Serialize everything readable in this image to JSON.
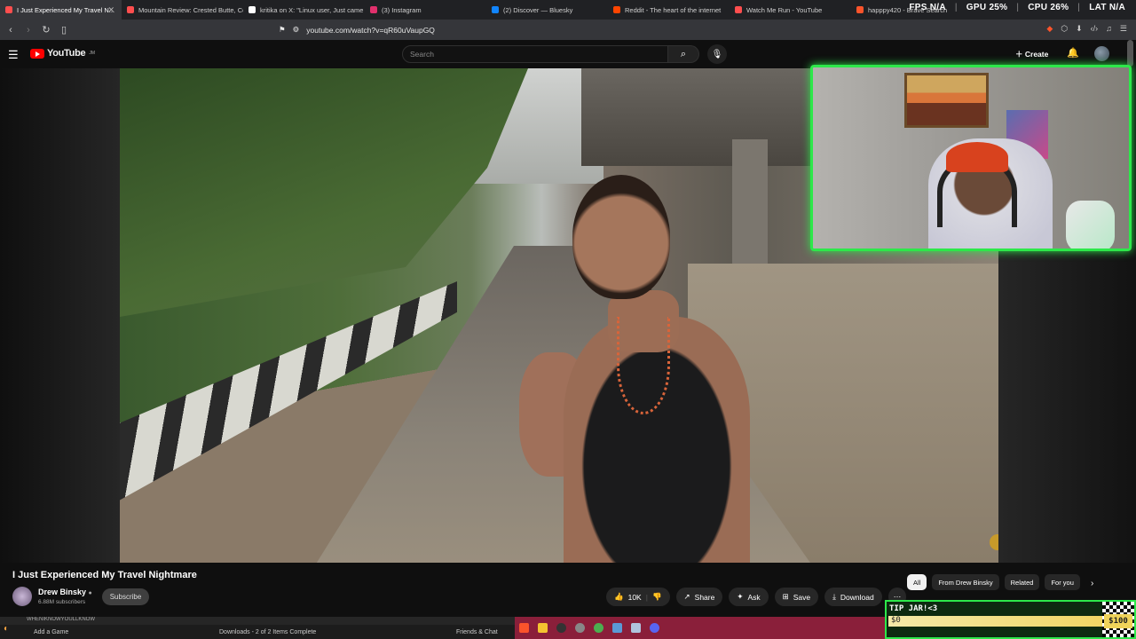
{
  "tabs": [
    {
      "label": "I Just Experienced My Travel N...",
      "color": "#ff4e4e",
      "active": true
    },
    {
      "label": "Mountain Review: Crested Butte, Colo...",
      "color": "#ff4e4e"
    },
    {
      "label": "kritika on X: \"Linux user, Just came a...",
      "color": "#ffffff"
    },
    {
      "label": "(3) Instagram",
      "color": "#e1306c"
    },
    {
      "label": "(2) Discover — Bluesky",
      "color": "#1185fe"
    },
    {
      "label": "Reddit - The heart of the internet",
      "color": "#ff4500"
    },
    {
      "label": "Watch Me Run - YouTube",
      "color": "#ff4e4e"
    },
    {
      "label": "happpy420 - Brave Search",
      "color": "#fb542b"
    }
  ],
  "stats": {
    "fps": "FPS N/A",
    "gpu": "GPU 25%",
    "cpu": "CPU 26%",
    "lat": "LAT N/A"
  },
  "address": {
    "url": "youtube.com/watch?v=qR60uVaupGQ"
  },
  "youtube": {
    "logo_text": "YouTube",
    "logo_region": "JM",
    "search_placeholder": "Search",
    "create_label": "Create"
  },
  "video": {
    "title": "I Just Experienced My Travel Nightmare",
    "channel": "Drew Binsky",
    "subscribers": "6.88M subscribers",
    "subscribe_label": "Subscribe"
  },
  "actions": {
    "likes": "10K",
    "share": "Share",
    "ask": "Ask",
    "save": "Save",
    "download": "Download"
  },
  "chips": [
    "All",
    "From Drew Binsky",
    "Related",
    "For you"
  ],
  "taskbar": {
    "upper_text": "WHENIKNOWYOULLKNOW",
    "add_game": "Add a Game",
    "downloads": "Downloads - 2 of 2 Items Complete",
    "friends": "Friends & Chat"
  },
  "tip_jar": {
    "label": "TIP JAR!<3",
    "current": "$0",
    "goal": "$100"
  },
  "colors": {
    "accent_green": "#2de84a",
    "youtube_red": "#ff0000",
    "tip_yellow": "#f0d35a"
  }
}
